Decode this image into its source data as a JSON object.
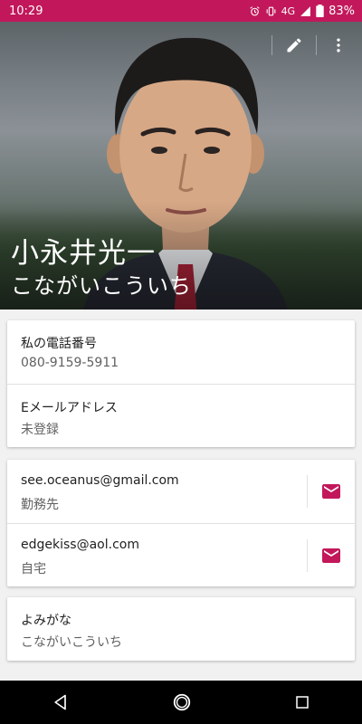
{
  "status_bar": {
    "time": "10:29",
    "network": "4G",
    "battery": "83%"
  },
  "header": {
    "name": "小永井光一",
    "reading": "こながいこういち",
    "edit_icon": "pencil-icon",
    "more_icon": "more-vert-icon"
  },
  "info_card": {
    "rows": [
      {
        "label": "私の電話番号",
        "value": "080-9159-5911"
      },
      {
        "label": "Eメールアドレス",
        "value": "未登録"
      }
    ]
  },
  "email_card": {
    "rows": [
      {
        "email": "see.oceanus@gmail.com",
        "type": "勤務先",
        "icon": "email-icon"
      },
      {
        "email": "edgekiss@aol.com",
        "type": "自宅",
        "icon": "email-icon"
      }
    ]
  },
  "reading_card": {
    "label": "よみがな",
    "value": "こながいこういち"
  },
  "colors": {
    "accent": "#c2185b",
    "status_bar": "#c2185b",
    "nav_bar": "#000000",
    "background": "#f1f1f1"
  }
}
